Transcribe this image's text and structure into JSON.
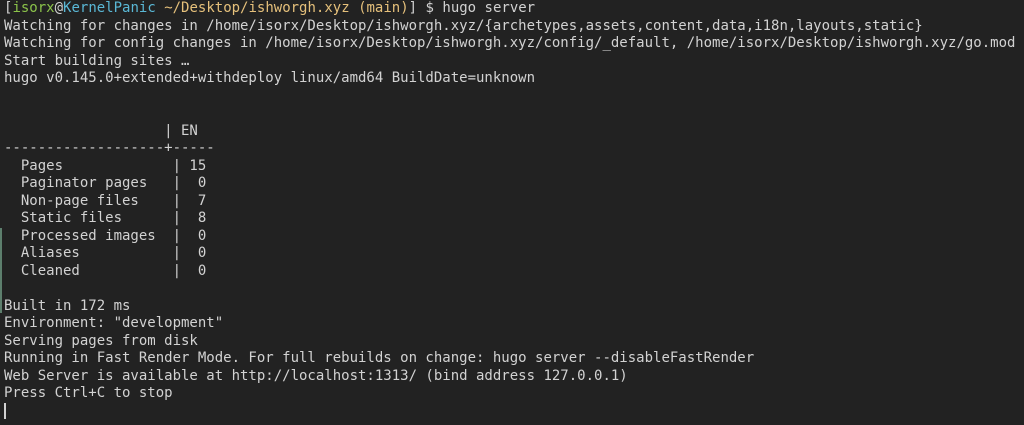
{
  "prompt": {
    "open_bracket": "[",
    "user": "isorx",
    "at": "@",
    "host": "KernelPanic",
    "path": "~/Desktop/ishworgh.xyz",
    "branch": "(main)",
    "close_bracket": "]",
    "symbol": "$",
    "command": "hugo server"
  },
  "output": {
    "watch_changes": "Watching for changes in /home/isorx/Desktop/ishworgh.xyz/{archetypes,assets,content,data,i18n,layouts,static}",
    "watch_config": "Watching for config changes in /home/isorx/Desktop/ishworgh.xyz/config/_default, /home/isorx/Desktop/ishworgh.xyz/go.mod",
    "start_building": "Start building sites …",
    "version": "hugo v0.145.0+extended+withdeploy linux/amd64 BuildDate=unknown",
    "table_header": "                   | EN",
    "table_separator": "-------------------+-----",
    "table_rows": [
      "  Pages             | 15",
      "  Paginator pages   |  0",
      "  Non-page files    |  7",
      "  Static files      |  8",
      "  Processed images  |  0",
      "  Aliases           |  0",
      "  Cleaned           |  0"
    ],
    "built_in": "Built in 172 ms",
    "environment": "Environment: \"development\"",
    "serving": "Serving pages from disk",
    "fast_render": "Running in Fast Render Mode. For full rebuilds on change: hugo server --disableFastRender",
    "web_server": "Web Server is available at http://localhost:1313/ (bind address 127.0.0.1)",
    "stop_hint": "Press Ctrl+C to stop"
  },
  "colors": {
    "background": "#222222",
    "text": "#d2d2d2",
    "user": "#8bc34a",
    "host": "#5ab8d6",
    "path": "#e5c07b",
    "gutter": "#5d7f6d"
  }
}
